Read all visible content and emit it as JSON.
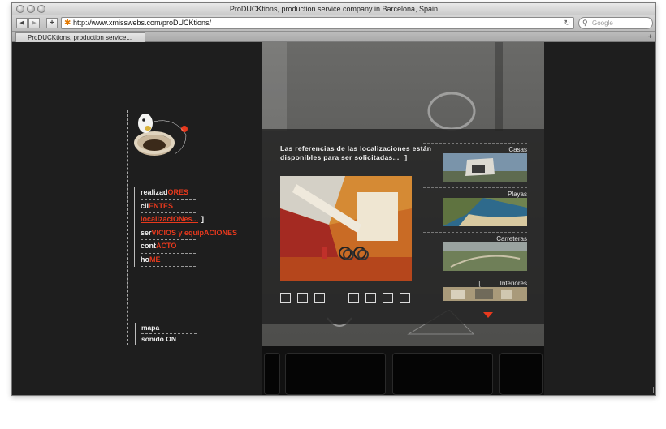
{
  "window": {
    "title": "ProDUCKtions, production service company in Barcelona, Spain"
  },
  "toolbar": {
    "back_label": "◀",
    "forward_label": "▶",
    "add_label": "+",
    "url": "http://www.xmisswebs.com/proDUCKtions/",
    "search_placeholder": "Google"
  },
  "tabs": [
    {
      "label": "ProDUCKtions, production service..."
    }
  ],
  "nav": {
    "items": [
      {
        "prefix": "realizad",
        "accent": "ORES"
      },
      {
        "prefix": "cli",
        "accent": "ENTES"
      },
      {
        "prefix": "localizacIONes...",
        "accent": ""
      },
      {
        "prefix": "ser",
        "accent": "VICIOS y equip",
        "suffix": "ACIONES"
      },
      {
        "prefix": "cont",
        "accent": "ACTO"
      },
      {
        "prefix": "ho",
        "accent": "ME"
      }
    ],
    "active_bracket": "]",
    "sub_items": [
      "mapa",
      "sonido ON"
    ]
  },
  "panel": {
    "intro_text": "Las referencias de las localizaciones están disponibles para ser solicitadas...",
    "bracket": "]",
    "categories": [
      "Casas",
      "Playas",
      "Carreteras",
      "Interiores"
    ],
    "interiores_bracket": "["
  },
  "colors": {
    "accent": "#e8391d",
    "background": "#1e1e1e",
    "text": "#f0f0f0"
  }
}
